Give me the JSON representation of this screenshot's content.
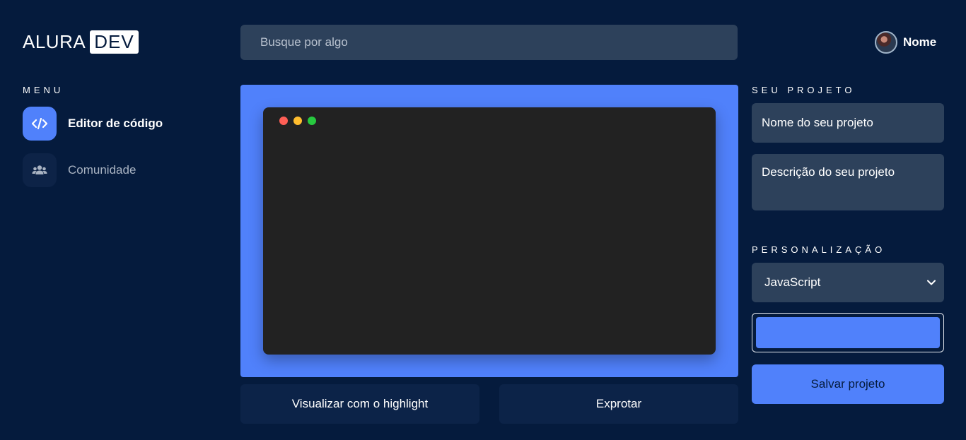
{
  "logo": {
    "part1": "ALURA",
    "part2": "DEV"
  },
  "search": {
    "placeholder": "Busque por algo"
  },
  "user": {
    "name": "Nome"
  },
  "menu": {
    "title": "MENU",
    "items": [
      {
        "label": "Editor de código",
        "icon": "code-icon",
        "active": true
      },
      {
        "label": "Comunidade",
        "icon": "users-icon",
        "active": false
      }
    ]
  },
  "editor": {
    "background": "#5081fb",
    "window_dots": [
      "#ff5f56",
      "#ffbd2e",
      "#27c93f"
    ]
  },
  "actions": {
    "highlight_label": "Visualizar com o highlight",
    "export_label": "Exprotar"
  },
  "project": {
    "title": "SEU PROJETO",
    "name_placeholder": "Nome do seu projeto",
    "description_placeholder": "Descrição do seu projeto"
  },
  "customization": {
    "title": "PERSONALIZAÇÃO",
    "language": "JavaScript",
    "color": "#5081fb",
    "save_label": "Salvar projeto"
  },
  "colors": {
    "background": "#051b3d",
    "accent": "#5081fb",
    "input": "#2d415b",
    "secondary_button": "#0c2348"
  }
}
